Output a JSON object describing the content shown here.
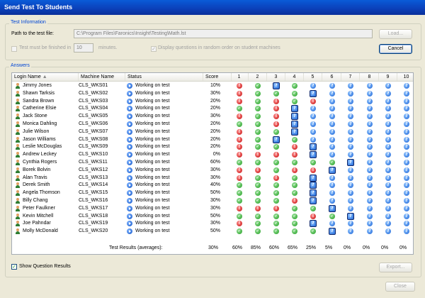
{
  "window": {
    "title": "Send Test To Students"
  },
  "test_info": {
    "legend": "Test Information",
    "path_label": "Path to the test file:",
    "path_value": "C:\\Program Files\\Faronics\\Insight\\Testing\\Math.lst",
    "load_button": "Load...",
    "finish_label": "Test must be finished in",
    "finish_value": "10",
    "minutes_label": "minutes.",
    "random_label": "Display questions in random order on student machines",
    "cancel_button": "Cancel"
  },
  "answers": {
    "legend": "Answers",
    "columns": {
      "login": "Login Name",
      "machine": "Machine Name",
      "status": "Status",
      "score": "Score",
      "questions": [
        "1",
        "2",
        "3",
        "4",
        "5",
        "6",
        "7",
        "8",
        "9",
        "10"
      ]
    },
    "icon_legend": {
      "q": "question-pending-icon",
      "ok": "correct-check-icon",
      "x": "wrong-exclamation-icon",
      "s": "question-in-progress-icon"
    },
    "rows": [
      {
        "name": "Jimmy Jones",
        "machine": "CLS_WKS01",
        "status": "Working on test",
        "score": "10%",
        "answers": [
          "x",
          "ok",
          "s",
          "ok",
          "q",
          "q",
          "q",
          "q",
          "q",
          "q"
        ]
      },
      {
        "name": "Shawn Tarksis",
        "machine": "CLS_WKS02",
        "status": "Working on test",
        "score": "30%",
        "answers": [
          "x",
          "ok",
          "ok",
          "ok",
          "s",
          "q",
          "q",
          "q",
          "q",
          "q"
        ]
      },
      {
        "name": "Sandra Brown",
        "machine": "CLS_WKS03",
        "status": "Working on test",
        "score": "20%",
        "answers": [
          "x",
          "ok",
          "x",
          "ok",
          "x",
          "q",
          "q",
          "q",
          "q",
          "q"
        ]
      },
      {
        "name": "Catherine Elsie",
        "machine": "CLS_WKS04",
        "status": "Working on test",
        "score": "20%",
        "answers": [
          "ok",
          "ok",
          "x",
          "s",
          "q",
          "q",
          "q",
          "q",
          "q",
          "q"
        ]
      },
      {
        "name": "Jack Stone",
        "machine": "CLS_WKS05",
        "status": "Working on test",
        "score": "30%",
        "answers": [
          "x",
          "ok",
          "x",
          "s",
          "q",
          "q",
          "q",
          "q",
          "q",
          "q"
        ]
      },
      {
        "name": "Monica Dahling",
        "machine": "CLS_WKS06",
        "status": "Working on test",
        "score": "20%",
        "answers": [
          "ok",
          "ok",
          "x",
          "s",
          "q",
          "q",
          "q",
          "q",
          "q",
          "q"
        ]
      },
      {
        "name": "Julie Wilson",
        "machine": "CLS_WKS07",
        "status": "Working on test",
        "score": "20%",
        "answers": [
          "x",
          "ok",
          "ok",
          "s",
          "q",
          "q",
          "q",
          "q",
          "q",
          "q"
        ]
      },
      {
        "name": "Jason Williams",
        "machine": "CLS_WKS08",
        "status": "Working on test",
        "score": "20%",
        "answers": [
          "x",
          "ok",
          "s",
          "ok",
          "q",
          "q",
          "q",
          "q",
          "q",
          "q"
        ]
      },
      {
        "name": "Leslie McDouglas",
        "machine": "CLS_WKS09",
        "status": "Working on test",
        "score": "20%",
        "answers": [
          "x",
          "ok",
          "ok",
          "x",
          "s",
          "q",
          "q",
          "q",
          "q",
          "q"
        ]
      },
      {
        "name": "Andrew Leckey",
        "machine": "CLS_WKS10",
        "status": "Working on test",
        "score": "0%",
        "answers": [
          "x",
          "x",
          "x",
          "x",
          "s",
          "q",
          "q",
          "q",
          "q",
          "q"
        ]
      },
      {
        "name": "Cynthia Rogers",
        "machine": "CLS_WKS11",
        "status": "Working on test",
        "score": "60%",
        "answers": [
          "ok",
          "ok",
          "ok",
          "ok",
          "ok",
          "ok",
          "s",
          "q",
          "q",
          "q"
        ]
      },
      {
        "name": "Borek Bolvin",
        "machine": "CLS_WKS12",
        "status": "Working on test",
        "score": "30%",
        "answers": [
          "x",
          "x",
          "ok",
          "x",
          "x",
          "s",
          "q",
          "q",
          "q",
          "q"
        ]
      },
      {
        "name": "Alan Travis",
        "machine": "CLS_WKS13",
        "status": "Working on test",
        "score": "30%",
        "answers": [
          "x",
          "ok",
          "x",
          "ok",
          "s",
          "q",
          "q",
          "q",
          "q",
          "q"
        ]
      },
      {
        "name": "Derek Smith",
        "machine": "CLS_WKS14",
        "status": "Working on test",
        "score": "40%",
        "answers": [
          "ok",
          "ok",
          "ok",
          "ok",
          "s",
          "q",
          "q",
          "q",
          "q",
          "q"
        ]
      },
      {
        "name": "Angela Thomson",
        "machine": "CLS_WKS15",
        "status": "Working on test",
        "score": "50%",
        "answers": [
          "ok",
          "ok",
          "ok",
          "ok",
          "s",
          "q",
          "q",
          "q",
          "q",
          "q"
        ]
      },
      {
        "name": "Billy Chang",
        "machine": "CLS_WKS16",
        "status": "Working on test",
        "score": "30%",
        "answers": [
          "ok",
          "ok",
          "ok",
          "x",
          "s",
          "q",
          "q",
          "q",
          "q",
          "q"
        ]
      },
      {
        "name": "Peter Faulkner",
        "machine": "CLS_WKS17",
        "status": "Working on test",
        "score": "30%",
        "answers": [
          "x",
          "x",
          "x",
          "ok",
          "ok",
          "s",
          "q",
          "q",
          "q",
          "q"
        ]
      },
      {
        "name": "Kevin Mitchell",
        "machine": "CLS_WKS18",
        "status": "Working on test",
        "score": "50%",
        "answers": [
          "ok",
          "ok",
          "ok",
          "ok",
          "x",
          "ok",
          "s",
          "q",
          "q",
          "q"
        ]
      },
      {
        "name": "Joe Pahndar",
        "machine": "CLS_WKS19",
        "status": "Working on test",
        "score": "30%",
        "answers": [
          "x",
          "ok",
          "ok",
          "ok",
          "s",
          "q",
          "q",
          "q",
          "q",
          "q"
        ]
      },
      {
        "name": "Molly McDonald",
        "machine": "CLS_WKS20",
        "status": "Working on test",
        "score": "50%",
        "answers": [
          "ok",
          "ok",
          "ok",
          "ok",
          "ok",
          "s",
          "q",
          "q",
          "q",
          "q"
        ]
      }
    ],
    "averages": {
      "label": "Test Results (averages):",
      "score": "30%",
      "questions": [
        "60%",
        "85%",
        "60%",
        "65%",
        "25%",
        "5%",
        "0%",
        "0%",
        "0%",
        "0%"
      ]
    }
  },
  "footer": {
    "show_results_label": "Show Question Results",
    "export_button": "Export...",
    "close_button": "Close"
  },
  "colors": {
    "title_bar": "#0B3FB8",
    "legend_text": "#0046D5",
    "dialog_bg": "#ECE9D8"
  }
}
